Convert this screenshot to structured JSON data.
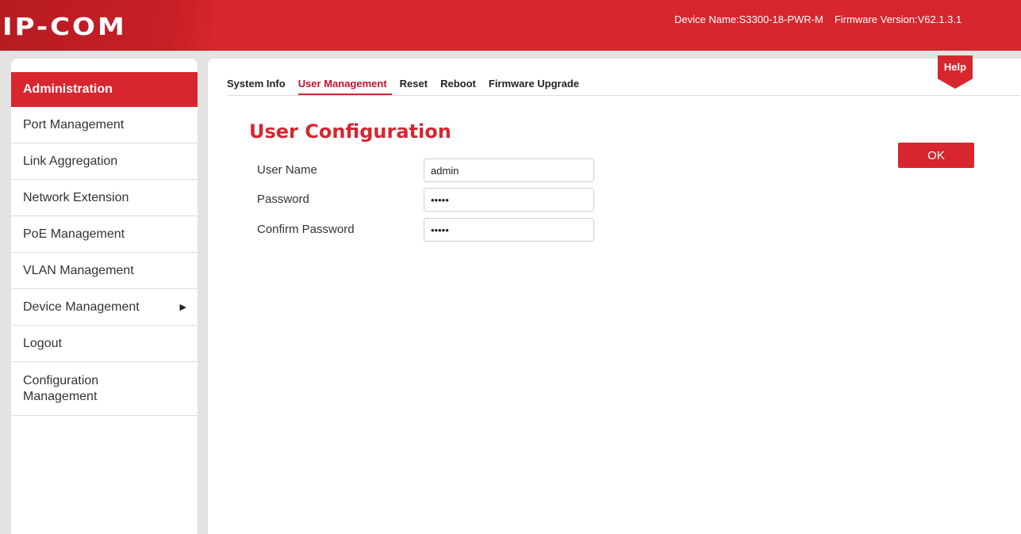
{
  "header": {
    "logo_text": "IP-COM",
    "device_name": "Device Name:S3300-18-PWR-M",
    "firmware_version": "Firmware Version:V62.1.3.1"
  },
  "sidebar": {
    "active_item": "Administration",
    "items": [
      {
        "label": "Port Management"
      },
      {
        "label": "Link Aggregation"
      },
      {
        "label": "Network Extension"
      },
      {
        "label": "PoE Management"
      },
      {
        "label": "VLAN Management"
      },
      {
        "label": "Device Management",
        "arrow": "▶"
      },
      {
        "label": "Logout"
      },
      {
        "label": "Configuration Management"
      }
    ]
  },
  "tabs": [
    {
      "label": "System Info",
      "active": false
    },
    {
      "label": "User Management",
      "active": true
    },
    {
      "label": "Reset",
      "active": false
    },
    {
      "label": "Reboot",
      "active": false
    },
    {
      "label": "Firmware Upgrade",
      "active": false
    }
  ],
  "help_label": "Help",
  "form": {
    "title": "User Configuration",
    "user_name_label": "User Name",
    "user_name_value": "admin",
    "password_label": "Password",
    "password_value": "•••••",
    "confirm_label": "Confirm Password",
    "confirm_value": "•••••",
    "ok_label": "OK"
  },
  "colors": {
    "brand_red": "#d7262e"
  }
}
